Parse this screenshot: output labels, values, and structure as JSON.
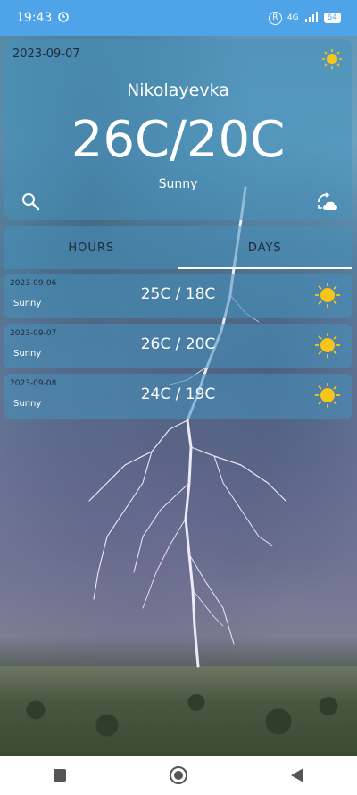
{
  "status_bar": {
    "time": "19:43",
    "network": "4G",
    "battery": "64"
  },
  "current": {
    "date": "2023-09-07",
    "city": "Nikolayevka",
    "temperature": "26C/20C",
    "condition": "Sunny"
  },
  "tabs": [
    {
      "label": "HOURS",
      "active": false
    },
    {
      "label": "DAYS",
      "active": true
    }
  ],
  "forecast": [
    {
      "date": "2023-09-06",
      "condition": "Sunny",
      "temp": "25C / 18C",
      "icon": "sun-icon"
    },
    {
      "date": "2023-09-07",
      "condition": "Sunny",
      "temp": "26C / 20C",
      "icon": "sun-icon"
    },
    {
      "date": "2023-09-08",
      "condition": "Sunny",
      "temp": "24C / 19C",
      "icon": "sun-icon"
    }
  ],
  "colors": {
    "accent": "#4fa3e8",
    "card": "#4691be",
    "sun": "#f7c51a"
  },
  "nav": [
    "square-icon",
    "circle-home-icon",
    "back-triangle-icon"
  ]
}
